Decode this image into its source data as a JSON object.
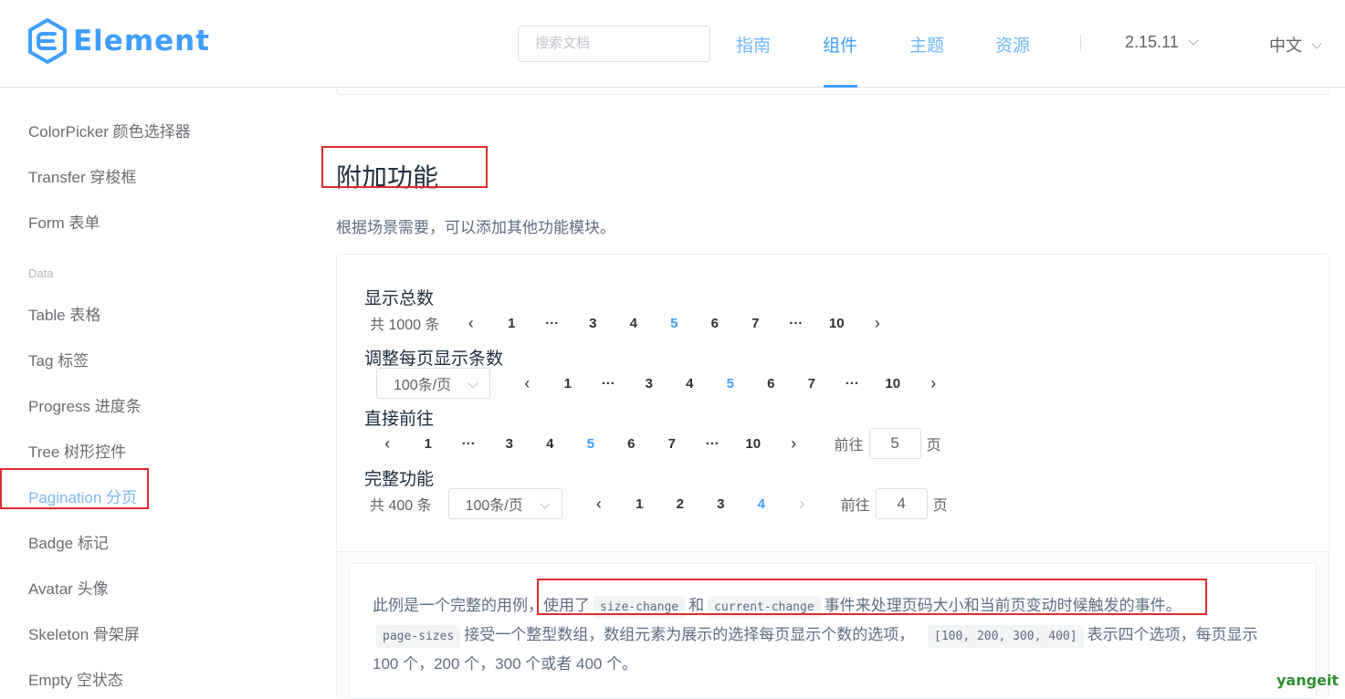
{
  "header": {
    "logo_text": "Element",
    "search_placeholder": "搜索文档",
    "nav": [
      "指南",
      "组件",
      "主题",
      "资源"
    ],
    "version": "2.15.11",
    "language": "中文"
  },
  "sidebar": {
    "items_top": [
      "ColorPicker 颜色选择器",
      "Transfer 穿梭框",
      "Form 表单"
    ],
    "group": "Data",
    "items": [
      "Table 表格",
      "Tag 标签",
      "Progress 进度条",
      "Tree 树形控件",
      "Pagination 分页",
      "Badge 标记",
      "Avatar 头像",
      "Skeleton 骨架屏",
      "Empty 空状态"
    ],
    "active": "Pagination 分页"
  },
  "section": {
    "title": "附加功能",
    "desc": "根据场景需要，可以添加其他功能模块。"
  },
  "demos": {
    "d1": {
      "label": "显示总数",
      "total": "共 1000 条",
      "pages": [
        "1",
        "···",
        "3",
        "4",
        "5",
        "6",
        "7",
        "···",
        "10"
      ],
      "current": "5"
    },
    "d2": {
      "label": "调整每页显示条数",
      "size": "100条/页",
      "pages": [
        "1",
        "···",
        "3",
        "4",
        "5",
        "6",
        "7",
        "···",
        "10"
      ],
      "current": "5"
    },
    "d3": {
      "label": "直接前往",
      "pages": [
        "1",
        "···",
        "3",
        "4",
        "5",
        "6",
        "7",
        "···",
        "10"
      ],
      "current": "5",
      "goto_prefix": "前往",
      "goto_value": "5",
      "goto_suffix": "页"
    },
    "d4": {
      "label": "完整功能",
      "total": "共 400 条",
      "size": "100条/页",
      "pages": [
        "1",
        "2",
        "3",
        "4"
      ],
      "current": "4",
      "goto_prefix": "前往",
      "goto_value": "4",
      "goto_suffix": "页"
    }
  },
  "description": {
    "p1_a": "此例是一个完整的用例，",
    "p1_b": "使用了",
    "code1": "size-change",
    "p1_c": "和",
    "code2": "current-change",
    "p1_d": "事件来处理页码大小和当前页变动时候触发的事件。",
    "code3": "page-sizes",
    "p2_a": "接受一个整型数组，数组元素为展示的选择每页显示个数的选项，",
    "code4": "[100, 200, 300, 400]",
    "p2_b": "表示四个选项，每页显示",
    "p3": "100 个，200 个，300 个或者 400 个。"
  },
  "watermark": "yangeit",
  "colors": {
    "primary": "#409eff",
    "highlight_border": "#e02b2b"
  }
}
